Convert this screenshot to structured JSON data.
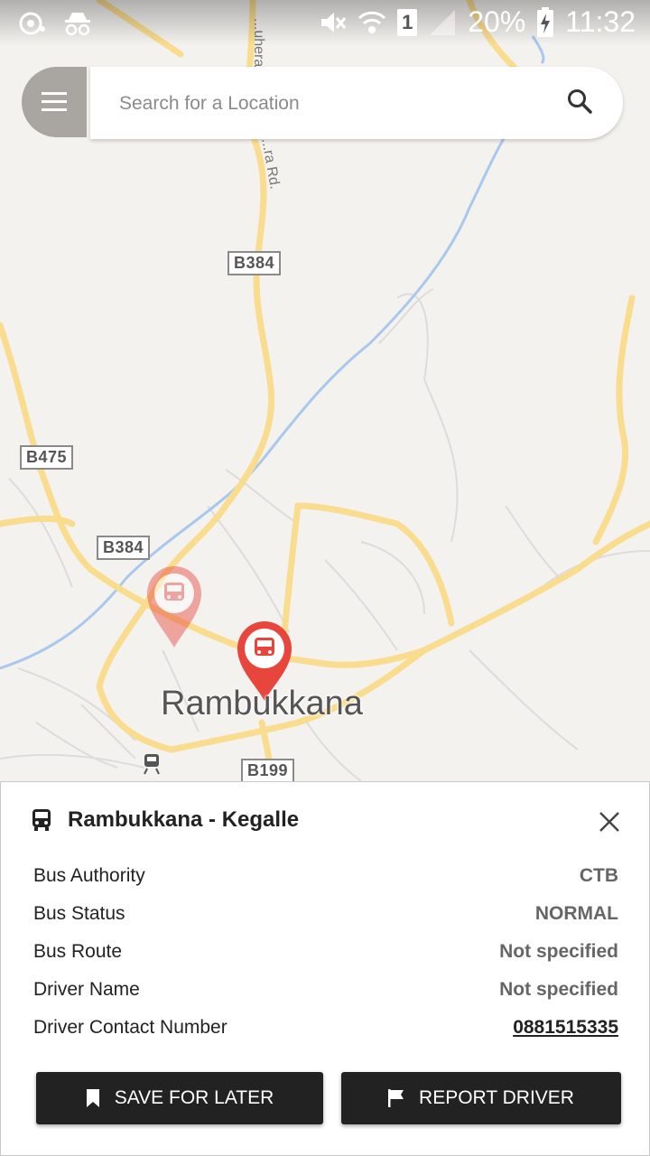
{
  "status_bar": {
    "battery": "20%",
    "time": "11:32",
    "sim_slot": "1",
    "icons": [
      "eye-sync-icon",
      "incognito-icon",
      "mute-icon",
      "wifi-icon",
      "sim-icon",
      "signal-icon",
      "battery-charging-icon"
    ]
  },
  "search": {
    "placeholder": "Search for a Location",
    "menu_icon": "hamburger-menu-icon",
    "search_icon": "search-icon"
  },
  "map": {
    "place_label": "Rambukkana",
    "road_labels": [
      "B384",
      "B475",
      "B384",
      "B199"
    ],
    "street_label": "...ra Rd.",
    "street_label_2": "...uhera",
    "markers": [
      {
        "icon": "bus-marker-icon",
        "state": "faded"
      },
      {
        "icon": "bus-marker-icon",
        "state": "selected"
      }
    ],
    "colors": {
      "road": "#fadc8e",
      "river": "#a9c8ee",
      "marker": "#e8453c"
    }
  },
  "panel": {
    "title": "Rambukkana - Kegalle",
    "title_icon": "bus-icon",
    "close_icon": "close-icon",
    "details": [
      {
        "label": "Bus Authority",
        "value": "CTB"
      },
      {
        "label": "Bus Status",
        "value": "NORMAL"
      },
      {
        "label": "Bus Route",
        "value": "Not specified"
      },
      {
        "label": "Driver Name",
        "value": "Not specified"
      },
      {
        "label": "Driver Contact Number",
        "value": "0881515335"
      }
    ],
    "save_label": "SAVE FOR LATER",
    "report_label": "REPORT DRIVER"
  }
}
